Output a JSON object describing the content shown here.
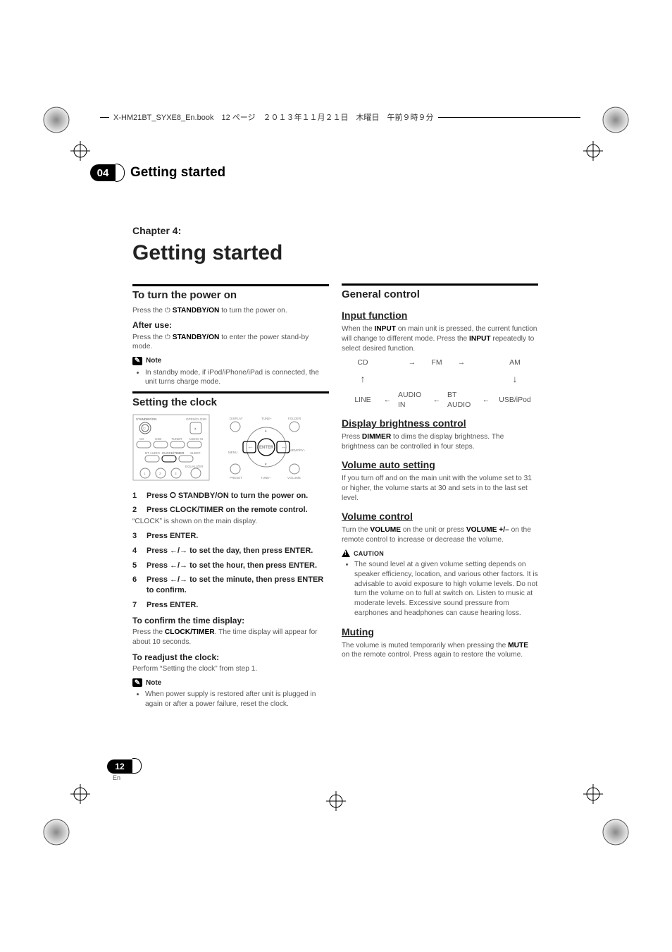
{
  "header_text": "X-HM21BT_SYXE8_En.book　12 ページ　２０１３年１１月２１日　木曜日　午前９時９分",
  "chapter_num": "04",
  "chapter_bar_title": "Getting started",
  "chapter_label": "Chapter 4:",
  "h1": "Getting started",
  "page_num": "12",
  "page_lang": "En",
  "left": {
    "section1": {
      "title": "To turn the power on",
      "line1_a": "Press the ",
      "line1_b": " STANDBY/ON",
      "line1_c": " to turn the power on.",
      "after_use": "After use:",
      "line2_a": "Press the ",
      "line2_b": " STANDBY/ON",
      "line2_c": " to enter the power stand-by mode.",
      "note_label": "Note",
      "note_bullet": "In standby mode, if iPod/iPhone/iPad is connected, the unit turns charge mode."
    },
    "section2": {
      "title": "Setting the clock",
      "step1": "Press ⭘ STANDBY/ON to turn the power on.",
      "step2": "Press CLOCK/TIMER on the remote control.",
      "step2_sub": "“CLOCK” is shown on the main display.",
      "step3": "Press ENTER.",
      "step4": "Press ←/→ to set the day, then press ENTER.",
      "step5": "Press ←/→ to set the hour, then press ENTER.",
      "step6": "Press ←/→ to set the minute, then press ENTER to confirm.",
      "step7": "Press ENTER.",
      "confirm_h": "To confirm the time display:",
      "confirm_a": "Press the ",
      "confirm_b": "CLOCK/TIMER",
      "confirm_c": ". The time display will appear for about 10 seconds.",
      "readjust_h": "To readjust the clock:",
      "readjust_p": "Perform “Setting the clock” from step 1.",
      "note_label": "Note",
      "note_bullet": "When power supply is restored after unit is plugged in again or after a power failure, reset the clock."
    },
    "remote_labels": {
      "standby": "STANDBY/ON",
      "open": "OPEN/CLOSE",
      "cd": "CD",
      "usb": "USB",
      "tuner": "TUNER",
      "audioin": "AUDIO IN",
      "bt": "BT AUDIO",
      "clock": "CLOCK/TIMER",
      "sleep": "SLEEP",
      "eq": "EQUALIZER",
      "n1": "1",
      "n2": "2",
      "n3": "3"
    },
    "panel_labels": {
      "display": "DISPLAY",
      "tunep": "TUNE+",
      "folder": "FOLDER",
      "enter": "ENTER",
      "menu": "MENU",
      "memory": "MEMORY /PROGRAM",
      "preset": "PRESET",
      "tunem": "TUNE–",
      "volume": "VOLUME"
    }
  },
  "right": {
    "section": {
      "title": "General control"
    },
    "input": {
      "h": "Input function",
      "p_a": "When the ",
      "p_b": "INPUT",
      "p_c": " on main unit is pressed, the current function will change to different mode. Press the ",
      "p_d": "INPUT",
      "p_e": " repeatedly to select desired function.",
      "flow": {
        "cd": "CD",
        "fm": "FM",
        "am": "AM",
        "line": "LINE",
        "audioin": "AUDIO IN",
        "bt": "BT AUDIO",
        "usb": "USB/iPod"
      }
    },
    "brightness": {
      "h": "Display brightness control",
      "p_a": "Press ",
      "p_b": "DIMMER",
      "p_c": " to dims the display brightness. The brightness can be controlled in four steps."
    },
    "volauto": {
      "h": "Volume auto setting",
      "p": "If you turn off and on the main unit with the volume set to 31 or higher, the volume starts at 30 and sets in to the last set level."
    },
    "volctrl": {
      "h": "Volume control",
      "p_a": "Turn the ",
      "p_b": "VOLUME",
      "p_c": " on the unit or press ",
      "p_d": "VOLUME +/–",
      "p_e": " on the remote control to increase or decrease the volume.",
      "caution_label": "CAUTION",
      "caution_bullet": "The sound level at a given volume setting depends on speaker efficiency, location, and various other factors. It is advisable to avoid exposure to high volume levels. Do not turn the volume on to full at switch on. Listen to music at moderate levels. Excessive sound pressure from earphones and headphones can cause hearing loss."
    },
    "muting": {
      "h": "Muting",
      "p_a": "The volume is muted temporarily when pressing the ",
      "p_b": "MUTE",
      "p_c": " on the remote control. Press again to restore the volume."
    }
  }
}
